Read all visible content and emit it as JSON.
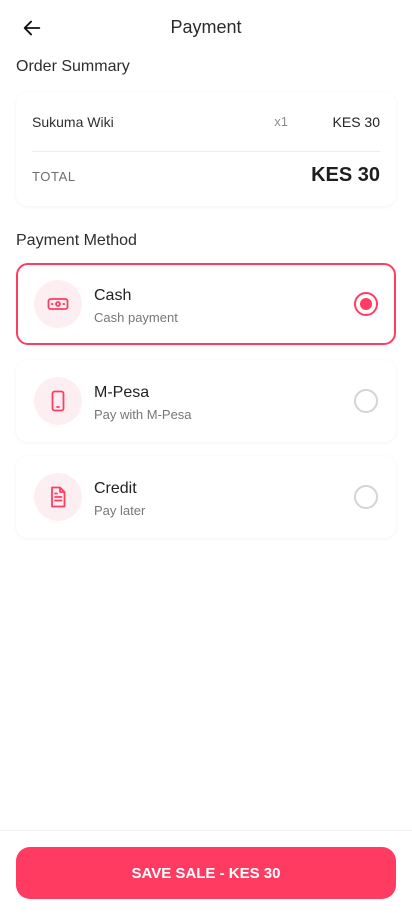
{
  "header": {
    "title": "Payment",
    "back_icon": "arrow-left-icon"
  },
  "order_summary": {
    "title": "Order Summary",
    "items": [
      {
        "name": "Sukuma Wiki",
        "qty": "x1",
        "price": "KES 30"
      }
    ],
    "total_label": "TOTAL",
    "total_value": "KES 30"
  },
  "payment_method": {
    "title": "Payment Method",
    "selected": "cash",
    "options": [
      {
        "id": "cash",
        "label": "Cash",
        "sub": "Cash payment",
        "icon": "cash-icon"
      },
      {
        "id": "mpesa",
        "label": "M-Pesa",
        "sub": "Pay with M-Pesa",
        "icon": "phone-icon"
      },
      {
        "id": "credit",
        "label": "Credit",
        "sub": "Pay later",
        "icon": "document-icon"
      }
    ]
  },
  "footer": {
    "save_label": "SAVE SALE - KES 30"
  },
  "colors": {
    "accent": "#ff3b61",
    "icon_bg": "#fdeef1"
  }
}
